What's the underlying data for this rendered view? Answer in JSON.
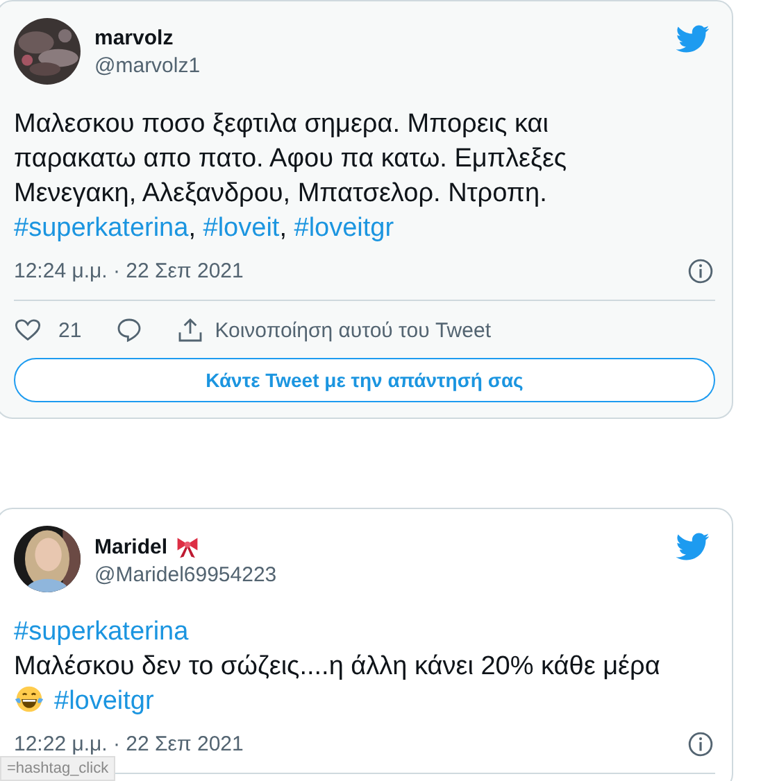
{
  "tweets": [
    {
      "name": "marvolz",
      "handle": "@marvolz1",
      "body": [
        {
          "kind": "text",
          "text": "Μαλεσκου ποσο ξεφτιλα σημερα. Μπορεις και παρακατω απο πατο. Αφου πα κατω. Εμπλεξες Μενεγακη, Αλεξανδρου, Μπατσελορ. Ντροπη."
        },
        {
          "kind": "break"
        },
        {
          "kind": "hashtag",
          "text": "#superkaterina"
        },
        {
          "kind": "text",
          "text": ", "
        },
        {
          "kind": "hashtag",
          "text": "#loveit"
        },
        {
          "kind": "text",
          "text": ", "
        },
        {
          "kind": "hashtag",
          "text": "#loveitgr"
        }
      ],
      "time": "12:24 μ.μ. · 22 Σεπ 2021",
      "likes": "21",
      "share": "Κοινοποίηση αυτού του Tweet",
      "reply_button": "Κάντε Tweet με την απάντησή σας"
    },
    {
      "name": "Maridel",
      "emoji_badge": true,
      "handle": "@Maridel69954223",
      "body": [
        {
          "kind": "hashtag",
          "text": "#superkaterina"
        },
        {
          "kind": "break"
        },
        {
          "kind": "text",
          "text": "Μαλέσκου δεν το σώζεις....η άλλη κάνει 20% κάθε μέρα"
        },
        {
          "kind": "break"
        },
        {
          "kind": "emoji"
        },
        {
          "kind": "hashtag",
          "text": "#loveitgr"
        }
      ],
      "time": "12:22 μ.μ. · 22 Σεπ 2021"
    }
  ],
  "status_tooltip": "=hashtag_click"
}
